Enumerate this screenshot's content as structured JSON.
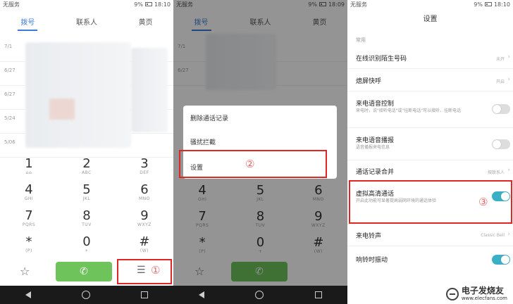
{
  "status": {
    "carrier": "无服务",
    "battery": "9%",
    "time_1": "18:10",
    "time_2": "18:09"
  },
  "tabs": [
    "拨号",
    "联系人",
    "黄页"
  ],
  "call_dates": [
    "7/1",
    "6/27",
    "6/27",
    "5/24",
    "5/06"
  ],
  "keys": [
    {
      "digit": "1",
      "letters": "⌂⌂"
    },
    {
      "digit": "2",
      "letters": "ABC"
    },
    {
      "digit": "3",
      "letters": "DEF"
    },
    {
      "digit": "4",
      "letters": "GHI"
    },
    {
      "digit": "5",
      "letters": "JKL"
    },
    {
      "digit": "6",
      "letters": "MNO"
    },
    {
      "digit": "7",
      "letters": "PQRS"
    },
    {
      "digit": "8",
      "letters": "TUV"
    },
    {
      "digit": "9",
      "letters": "WXYZ"
    },
    {
      "digit": "*",
      "letters": "(P)"
    },
    {
      "digit": "0",
      "letters": "+"
    },
    {
      "digit": "#",
      "letters": "(W)"
    }
  ],
  "menu": {
    "items": [
      "删除通话记录",
      "骚扰拦截",
      "设置"
    ]
  },
  "steps": [
    "①",
    "②",
    "③"
  ],
  "settings": {
    "title": "设置",
    "section": "常用",
    "rows": [
      {
        "title": "在线识别陌生号码",
        "value": "未开"
      },
      {
        "title": "熄屏快呼",
        "value": "开启"
      },
      {
        "title": "来电语音控制",
        "desc": "来电时，说\"接听电话\"或\"挂断电话\"可以接听、挂断电话"
      },
      {
        "title": "来电语音播报",
        "desc": "语音播报来电信息"
      },
      {
        "title": "通话记录合并",
        "value": "按联系人"
      },
      {
        "title": "虚拟高清通话",
        "desc": "开启此功能可显著提高弱网环境的通话体验"
      },
      {
        "title": "来电铃声",
        "value": "Classic Bell"
      },
      {
        "title": "响铃时振动"
      }
    ]
  },
  "watermark": {
    "cn": "电子发烧友",
    "url": "www.elecfans.com"
  },
  "colors": {
    "accent": "#3a7bd5",
    "call_green": "#6fc35b",
    "toggle_on": "#3ab0c6",
    "highlight": "#e02525"
  },
  "icons": [
    "star-icon",
    "phone-icon",
    "menu-icon",
    "back-icon",
    "home-icon",
    "recents-icon",
    "chevron-right-icon"
  ]
}
